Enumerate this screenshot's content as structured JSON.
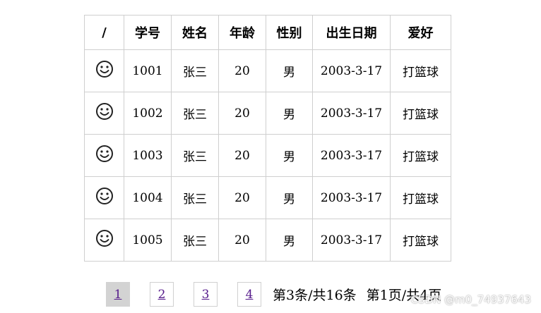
{
  "table": {
    "headers": [
      "/",
      "学号",
      "姓名",
      "年龄",
      "性别",
      "出生日期",
      "爱好"
    ],
    "rows": [
      {
        "icon": "smile-icon",
        "id": "1001",
        "name": "张三",
        "age": "20",
        "gender": "男",
        "birth": "2003-3-17",
        "hobby": "打篮球"
      },
      {
        "icon": "smile-icon",
        "id": "1002",
        "name": "张三",
        "age": "20",
        "gender": "男",
        "birth": "2003-3-17",
        "hobby": "打篮球"
      },
      {
        "icon": "smile-icon",
        "id": "1003",
        "name": "张三",
        "age": "20",
        "gender": "男",
        "birth": "2003-3-17",
        "hobby": "打篮球"
      },
      {
        "icon": "smile-icon",
        "id": "1004",
        "name": "张三",
        "age": "20",
        "gender": "男",
        "birth": "2003-3-17",
        "hobby": "打篮球"
      },
      {
        "icon": "smile-icon",
        "id": "1005",
        "name": "张三",
        "age": "20",
        "gender": "男",
        "birth": "2003-3-17",
        "hobby": "打篮球"
      }
    ]
  },
  "pagination": {
    "pages": [
      "1",
      "2",
      "3",
      "4"
    ],
    "active_page": "1",
    "record_info": "第3条/共16条",
    "page_info": "第1页/共4页"
  },
  "watermark": "CSDN @m0_74937643",
  "colors": {
    "border": "#cfcfcf",
    "link": "#551a8b",
    "active_page_bg": "#d3d3d3"
  }
}
